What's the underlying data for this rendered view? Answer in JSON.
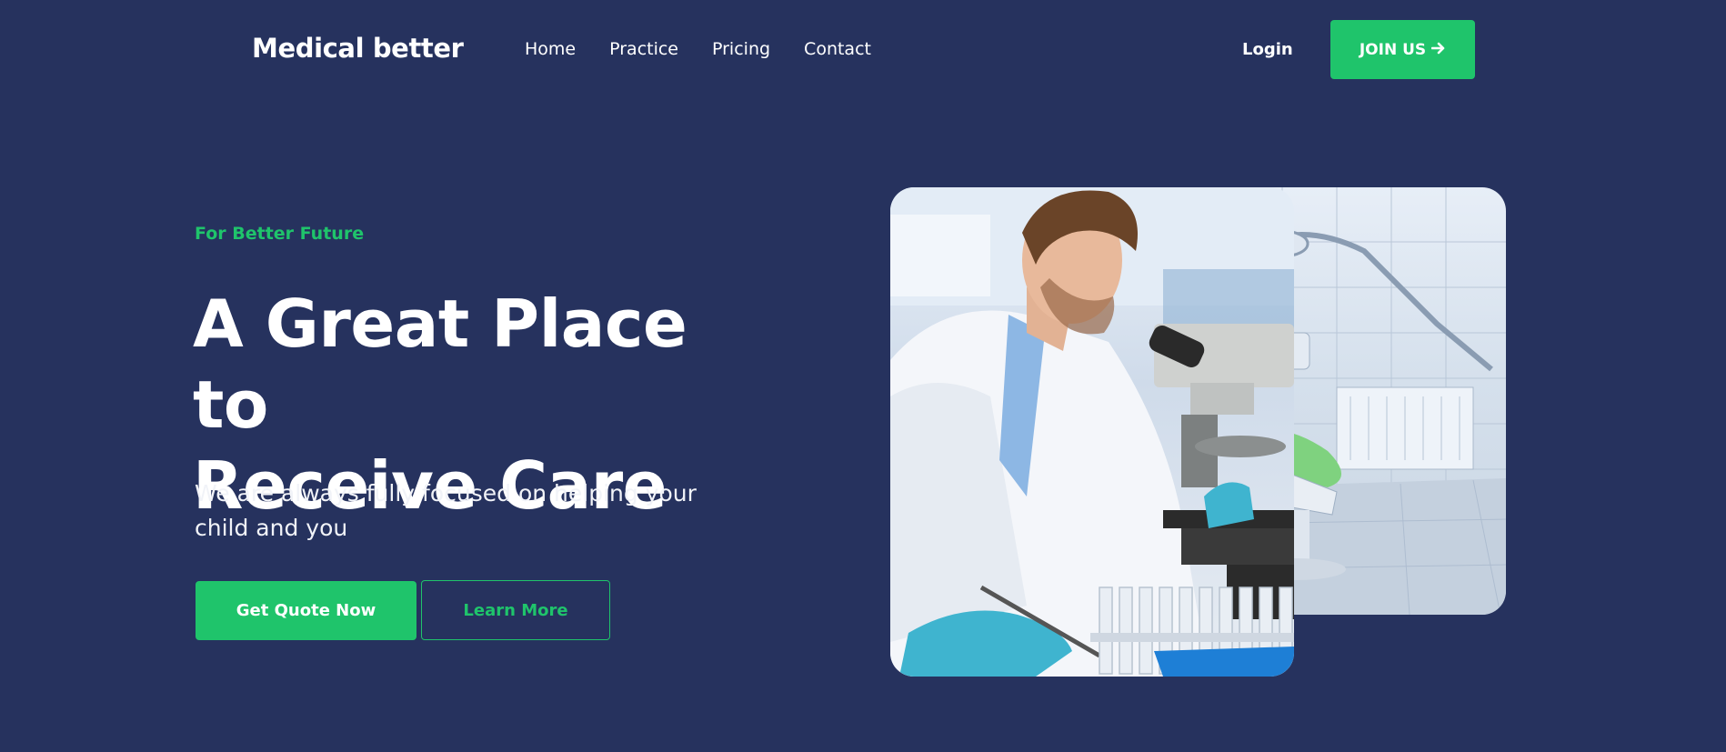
{
  "header": {
    "brand": "Medical better",
    "nav": [
      {
        "label": "Home"
      },
      {
        "label": "Practice"
      },
      {
        "label": "Pricing"
      },
      {
        "label": "Contact"
      }
    ],
    "login_label": "Login",
    "join_label": "JOIN US"
  },
  "hero": {
    "kicker": "For Better Future",
    "headline_line1": "A Great Place to",
    "headline_line2": "Receive Care",
    "subtitle": "We are always fully focused on helping your child and you",
    "primary_cta": "Get Quote Now",
    "secondary_cta": "Learn More"
  },
  "images": {
    "front": {
      "icon": "scientist-microscope-photo"
    },
    "back": {
      "icon": "dental-clinic-photo"
    }
  },
  "colors": {
    "background": "#26325e",
    "accent": "#1fc46b",
    "text": "#ffffff"
  }
}
